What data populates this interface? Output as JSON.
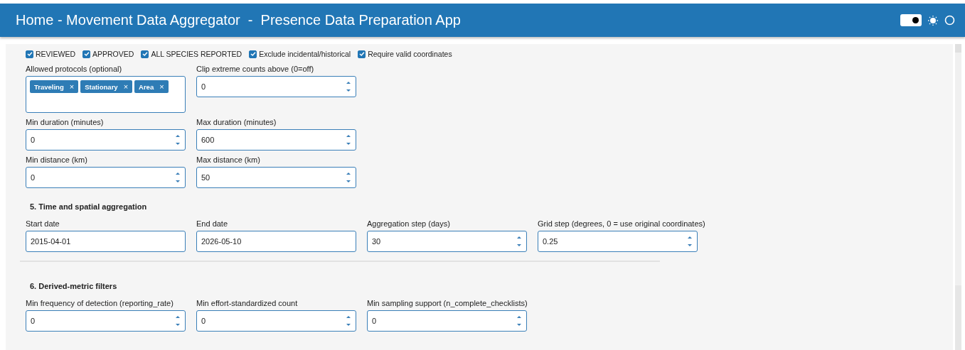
{
  "header": {
    "title": "Home - Movement Data Aggregator  -  Presence Data Preparation App",
    "theme_toggle": {
      "on": true
    }
  },
  "filters": {
    "checkboxes": [
      {
        "label": "REVIEWED",
        "checked": true
      },
      {
        "label": "APPROVED",
        "checked": true
      },
      {
        "label": "ALL SPECIES REPORTED",
        "checked": true
      },
      {
        "label": "Exclude incidental/historical",
        "checked": true
      },
      {
        "label": "Require valid coordinates",
        "checked": true
      }
    ],
    "rows": [
      [
        {
          "kind": "tags",
          "label": "Allowed protocols (optional)",
          "tags": [
            {
              "label": "Traveling",
              "remove": "×"
            },
            {
              "label": "Stationary",
              "remove": "×"
            },
            {
              "label": "Area",
              "remove": "×"
            }
          ]
        },
        {
          "kind": "number",
          "label": "Clip extreme counts above (0=off)",
          "value": "0"
        }
      ],
      [
        {
          "kind": "number",
          "label": "Min duration (minutes)",
          "value": "0"
        },
        {
          "kind": "number",
          "label": "Max duration (minutes)",
          "value": "600"
        }
      ],
      [
        {
          "kind": "number",
          "label": "Min distance (km)",
          "value": "0"
        },
        {
          "kind": "number",
          "label": "Max distance (km)",
          "value": "50"
        }
      ]
    ]
  },
  "sections": [
    {
      "title": "5. Time and spatial aggregation",
      "rows": [
        [
          {
            "kind": "text",
            "label": "Start date",
            "value": "2015-04-01"
          },
          {
            "kind": "text",
            "label": "End date",
            "value": "2026-05-10"
          },
          {
            "kind": "number",
            "label": "Aggregation step (days)",
            "value": "30"
          },
          {
            "kind": "number",
            "label": "Grid step (degrees, 0 = use original coordinates)",
            "value": "0.25"
          }
        ]
      ]
    },
    {
      "title": "6. Derived-metric filters",
      "rows": [
        [
          {
            "kind": "number",
            "label": "Min frequency of detection (reporting_rate)",
            "value": "0"
          },
          {
            "kind": "number",
            "label": "Min effort-standardized count",
            "value": "0"
          },
          {
            "kind": "number",
            "label": "Min sampling support (n_complete_checklists)",
            "value": "0"
          }
        ]
      ]
    }
  ]
}
